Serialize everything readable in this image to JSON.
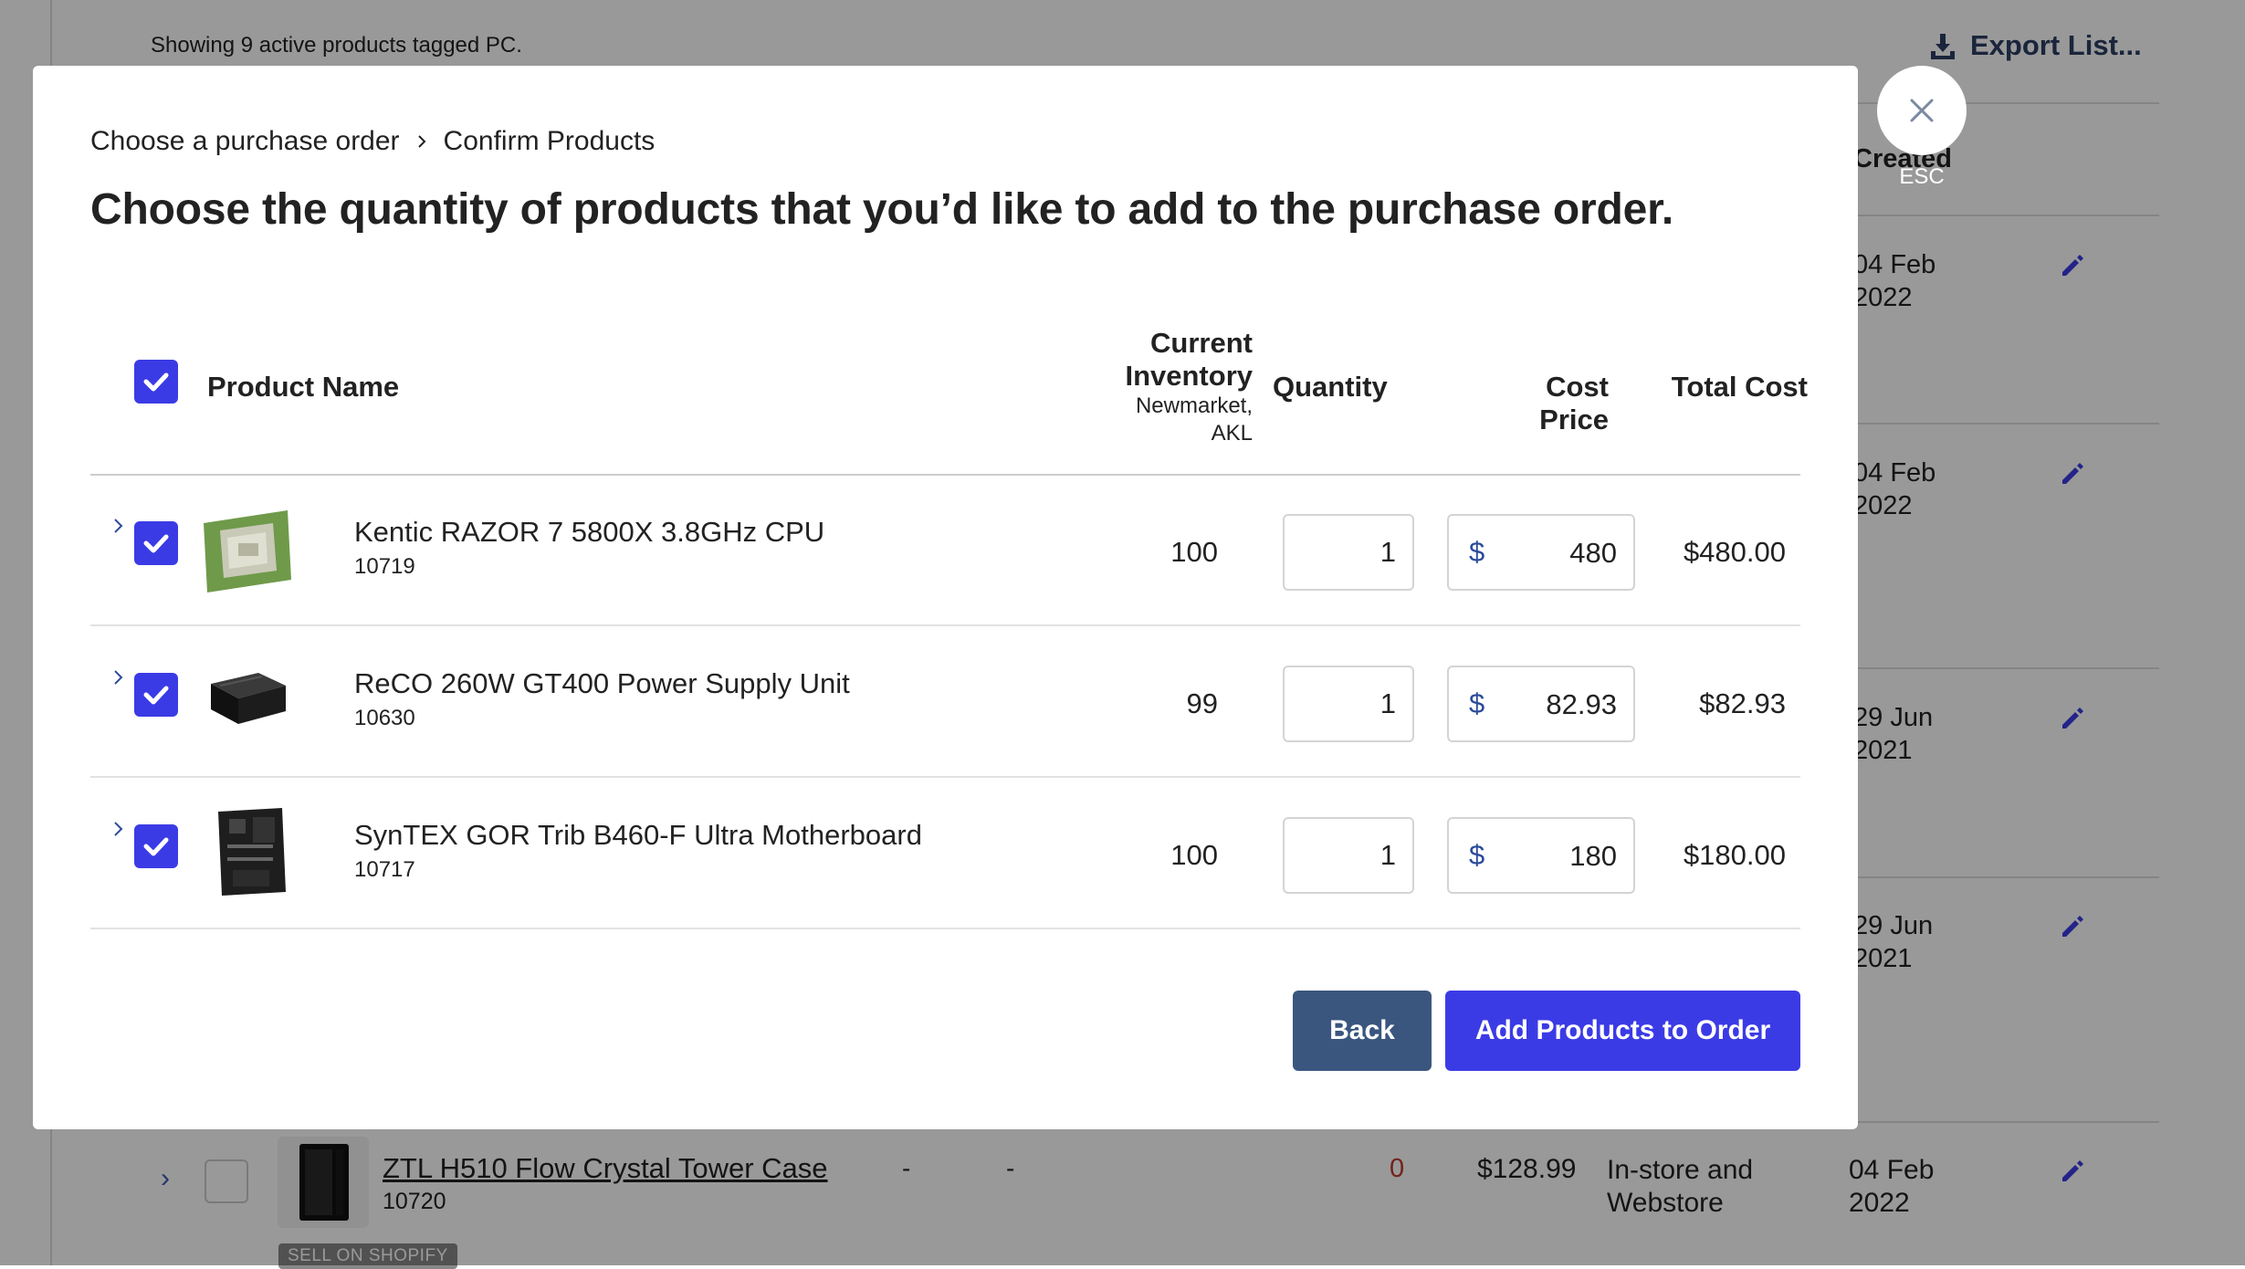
{
  "background": {
    "summary_text": "Showing 9 active products tagged PC.",
    "export_label": "Export List...",
    "created_header": "Created",
    "dates": [
      "04 Feb 2022",
      "04 Feb 2022",
      "29 Jun 2021",
      "29 Jun 2021"
    ],
    "product_row": {
      "name": "ZTL H510 Flow Crystal Tower Case",
      "sku": "10720",
      "col_a": "-",
      "col_b": "-",
      "stock": "0",
      "price": "$128.99",
      "channel": "In-store and Webstore",
      "date": "04 Feb 2022",
      "badge": "SELL ON SHOPIFY"
    }
  },
  "modal": {
    "breadcrumb": {
      "step1": "Choose a purchase order",
      "step2": "Confirm Products"
    },
    "title": "Choose the quantity of products that you’d like to add to the purchase order.",
    "close_label": "ESC",
    "table": {
      "headers": {
        "product_name": "Product Name",
        "current_inventory": "Current Inventory",
        "location": "Newmarket, AKL",
        "quantity": "Quantity",
        "cost_price": "Cost Price",
        "total_cost": "Total Cost"
      },
      "currency_symbol": "$",
      "rows": [
        {
          "name": "Kentic RAZOR 7 5800X 3.8GHz CPU",
          "sku": "10719",
          "inventory": "100",
          "quantity": "1",
          "cost": "480",
          "total": "$480.00",
          "icon": "cpu-thumbnail"
        },
        {
          "name": "ReCO 260W GT400 Power Supply Unit",
          "sku": "10630",
          "inventory": "99",
          "quantity": "1",
          "cost": "82.93",
          "total": "$82.93",
          "icon": "psu-thumbnail"
        },
        {
          "name": "SynTEX GOR Trib B460-F Ultra Motherboard",
          "sku": "10717",
          "inventory": "100",
          "quantity": "1",
          "cost": "180",
          "total": "$180.00",
          "icon": "motherboard-thumbnail"
        }
      ]
    },
    "buttons": {
      "back": "Back",
      "add": "Add Products to Order"
    }
  },
  "colors": {
    "accent": "#3b3be6",
    "back_button": "#3a567f",
    "overlay": "rgba(0,0,0,0.40)"
  }
}
